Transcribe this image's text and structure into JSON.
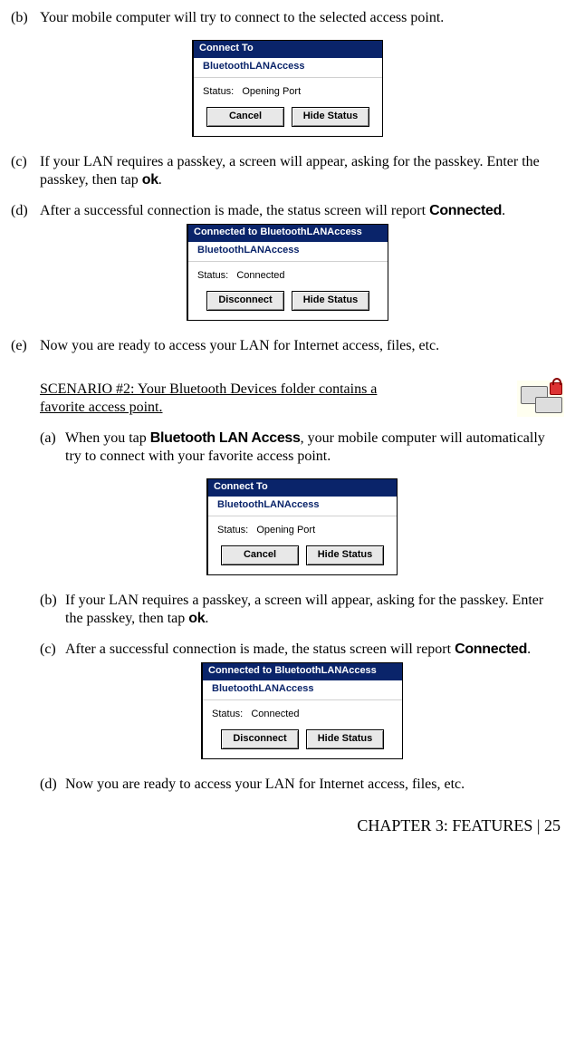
{
  "items1": {
    "b": {
      "marker": "(b)",
      "text": "Your mobile computer will try to connect to the selected access point."
    },
    "c": {
      "marker": "(c)",
      "text_before": "If your LAN requires a passkey, a screen will appear, asking for the passkey.  Enter the passkey, then tap ",
      "bold": "ok",
      "text_after": "."
    },
    "d": {
      "marker": "(d)",
      "text_before": "After a successful connection is made, the status screen will report ",
      "bold": "Connected",
      "text_after": "."
    },
    "e": {
      "marker": "(e)",
      "text": "Now you are ready to access your LAN for Internet access, files, etc."
    }
  },
  "scenario2": {
    "title": "SCENARIO #2: Your Bluetooth Devices folder contains a favorite access point.",
    "a": {
      "marker": "(a)",
      "before": "When you tap ",
      "bold": "Bluetooth LAN Access",
      "after": ", your mobile computer will automatically try to connect with your favorite access point."
    },
    "b": {
      "marker": "(b)",
      "before": "If your LAN requires a passkey, a screen will appear, asking for the passkey.  Enter the passkey, then tap ",
      "bold": "ok",
      "after": "."
    },
    "c": {
      "marker": "(c)",
      "before": "After a successful connection is made, the status screen will report ",
      "bold": "Connected",
      "after": "."
    },
    "d": {
      "marker": "(d)",
      "text": "Now you are ready to access your LAN for Internet access, files, etc."
    }
  },
  "dlg_connect": {
    "title": "Connect To",
    "sub": "BluetoothLANAccess",
    "status_label": "Status:",
    "status_value": "Opening Port",
    "btn_left": "Cancel",
    "btn_right": "Hide Status"
  },
  "dlg_connected": {
    "title": "Connected to BluetoothLANAccess",
    "sub": "BluetoothLANAccess",
    "status_label": "Status:",
    "status_value": "Connected",
    "btn_left": "Disconnect",
    "btn_right": "Hide Status"
  },
  "footer": "CHAPTER 3: FEATURES | 25"
}
